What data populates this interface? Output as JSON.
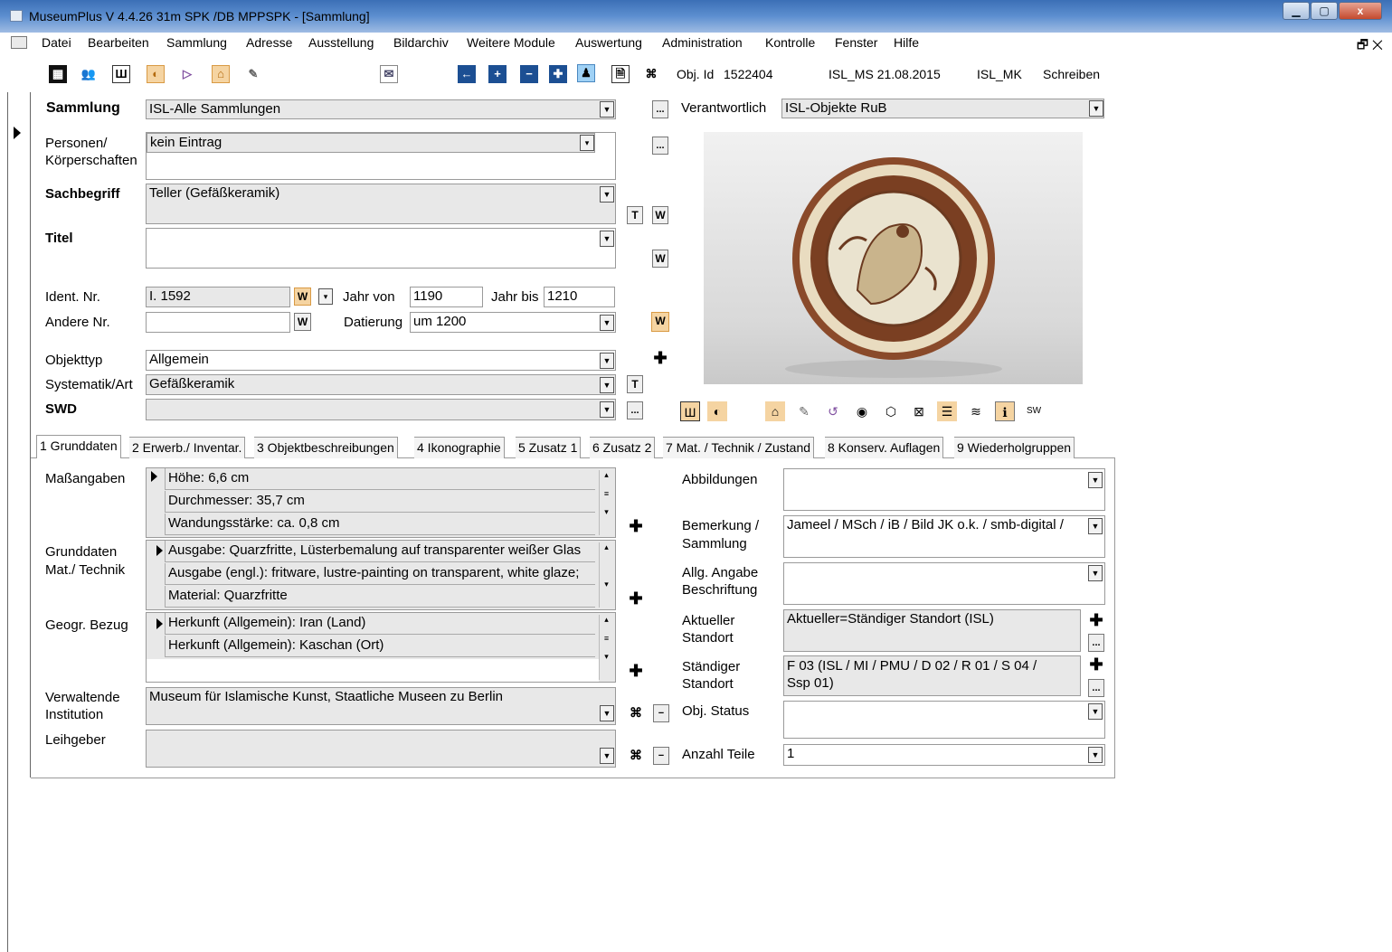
{
  "window": {
    "title": "MuseumPlus V 4.4.26 31m SPK /DB MPPSPK - [Sammlung]",
    "btn_min": "▁",
    "btn_max": "▢",
    "btn_close": "x"
  },
  "menu": [
    "Datei",
    "Bearbeiten",
    "Sammlung",
    "Adresse",
    "Ausstellung",
    "Bildarchiv",
    "Weitere Module",
    "Auswertung",
    "Administration",
    "Kontrolle",
    "Fenster",
    "Hilfe"
  ],
  "menu_right": "🗗 ✕",
  "toolbar": {
    "obj_id_label": "Obj. Id",
    "obj_id": "1522404",
    "user_date": "ISL_MS 21.08.2015",
    "user2": "ISL_MK",
    "mode": "Schreiben"
  },
  "header": {
    "sammlung_label": "Sammlung",
    "sammlung_value": "ISL-Alle Sammlungen",
    "verantwortlich_label": "Verantwortlich",
    "verantwortlich_value": "ISL-Objekte RuB"
  },
  "form": {
    "personen_label": "Personen/",
    "personen_label2": "Körperschaften",
    "personen_value": "kein Eintrag",
    "sachbegriff_label": "Sachbegriff",
    "sachbegriff_value": "Teller (Gefäßkeramik)",
    "titel_label": "Titel",
    "titel_value": "",
    "ident_label": "Ident. Nr.",
    "ident_value": "I. 1592",
    "jahr_von_label": "Jahr von",
    "jahr_von_value": "1190",
    "jahr_bis_label": "Jahr bis",
    "jahr_bis_value": "1210",
    "andere_label": "Andere Nr.",
    "andere_value": "",
    "datierung_label": "Datierung",
    "datierung_value": "um 1200",
    "objekttyp_label": "Objekttyp",
    "objekttyp_value": "Allgemein",
    "systematik_label": "Systematik/Art",
    "systematik_value": "Gefäßkeramik",
    "swd_label": "SWD",
    "swd_value": ""
  },
  "tabs": [
    "1 Grunddaten",
    "2 Erwerb./ Inventar.",
    "3 Objektbeschreibungen",
    "4 Ikonographie",
    "5 Zusatz 1",
    "6 Zusatz 2",
    "7 Mat. / Technik / Zustand",
    "8 Konserv. Auflagen",
    "9 Wiederholgruppen"
  ],
  "grunddaten": {
    "masse_label": "Maßangaben",
    "masse": [
      "Höhe: 6,6 cm",
      "Durchmesser: 35,7 cm",
      "Wandungsstärke: ca. 0,8 cm"
    ],
    "mat_label": "Grunddaten",
    "mat_label2": "Mat./ Technik",
    "mat": [
      "Ausgabe: Quarzfritte, Lüsterbemalung auf transparenter weißer Glas",
      "Ausgabe (engl.): fritware, lustre-painting on transparent, white glaze;",
      "Material: Quarzfritte"
    ],
    "geo_label": "Geogr. Bezug",
    "geo": [
      "Herkunft (Allgemein): Iran (Land)",
      "Herkunft (Allgemein): Kaschan (Ort)"
    ],
    "verw_label": "Verwaltende",
    "verw_label2": "Institution",
    "verw_value": "Museum für Islamische Kunst, Staatliche Museen zu Berlin",
    "leih_label": "Leihgeber",
    "leih_value": "",
    "abb_label": "Abbildungen",
    "abb_value": "",
    "bem_label": "Bemerkung /",
    "bem_label2": "Sammlung",
    "bem_value": "Jameel / MSch / iB / Bild JK o.k. / smb-digital /",
    "allg_label": "Allg. Angabe",
    "allg_label2": "Beschriftung",
    "allg_value": "",
    "akt_label": "Aktueller",
    "akt_label2": "Standort",
    "akt_value": "Aktueller=Ständiger Standort (ISL)",
    "staend_label": "Ständiger",
    "staend_label2": "Standort",
    "staend_value": "F 03 (ISL / MI / PMU / D 02 / R 01 / S 04 /",
    "staend_value2": "Ssp 01)",
    "status_label": "Obj. Status",
    "status_value": "",
    "anzahl_label": "Anzahl Teile",
    "anzahl_value": "1"
  },
  "buttons": {
    "dots": "...",
    "w": "W",
    "t": "T",
    "plus": "✚",
    "minus": "−",
    "binoc": "⌘",
    "dd": "▼",
    "star": "▾"
  },
  "colors": {
    "titlebar": "#3b6fb6",
    "plate_brown": "#8a4a2a",
    "plate_cream": "#eae3cf"
  }
}
